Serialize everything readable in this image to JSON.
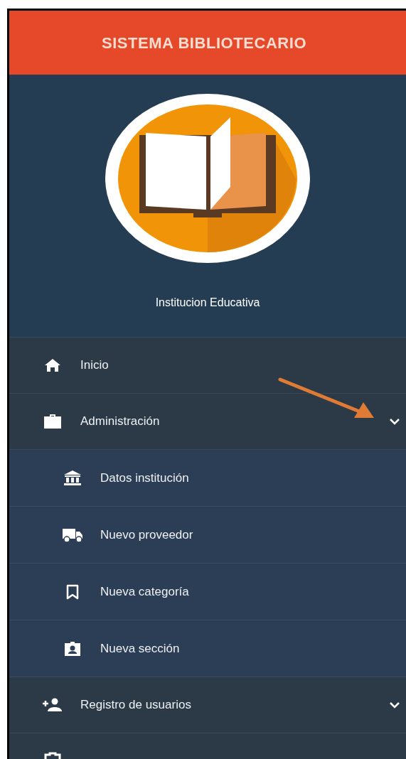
{
  "header": {
    "title": "SISTEMA BIBLIOTECARIO"
  },
  "profile": {
    "name": "Institucion Educativa"
  },
  "menu": [
    {
      "label": "Inicio",
      "kind": "link"
    },
    {
      "label": "Administración",
      "kind": "group",
      "children": [
        {
          "label": "Datos institución"
        },
        {
          "label": "Nuevo proveedor"
        },
        {
          "label": "Nueva categoría"
        },
        {
          "label": "Nueva sección"
        }
      ]
    },
    {
      "label": "Registro de usuarios",
      "kind": "group"
    },
    {
      "kind": "link"
    }
  ]
}
